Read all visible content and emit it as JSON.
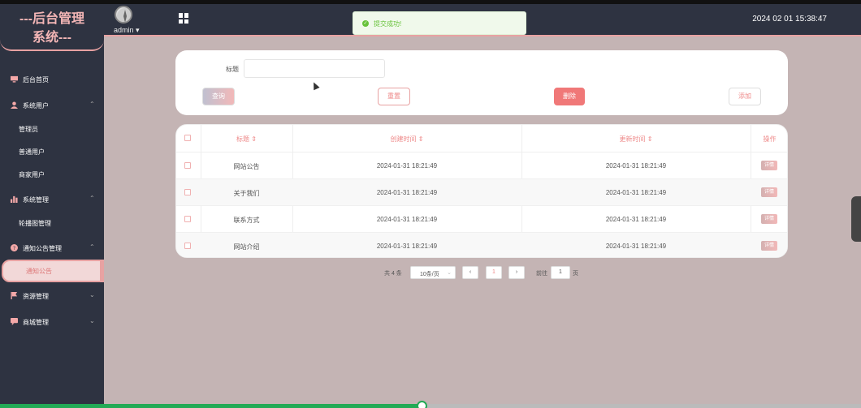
{
  "app": {
    "logo_line1": "---后台管理",
    "logo_line2": "系统---"
  },
  "header": {
    "user": "admin",
    "user_caret": "▾",
    "datetime": "2024 02 01 15:38:47"
  },
  "toast": {
    "icon": "✓",
    "message": "提交成功!"
  },
  "sidebar": {
    "items": [
      {
        "label": "后台首页",
        "icon": "monitor-icon",
        "chev": ""
      },
      {
        "label": "系统用户",
        "icon": "user-icon",
        "chev": "⌃"
      },
      {
        "label": "系统管理",
        "icon": "bar-chart-icon",
        "chev": "⌃"
      },
      {
        "label": "通知公告管理",
        "icon": "question-icon",
        "chev": "⌃"
      },
      {
        "label": "资源管理",
        "icon": "flag-icon",
        "chev": "⌄"
      },
      {
        "label": "商城管理",
        "icon": "chat-icon",
        "chev": "⌄"
      }
    ],
    "subitems": [
      {
        "label": "管理员"
      },
      {
        "label": "普通用户"
      },
      {
        "label": "商家用户"
      },
      {
        "label": "轮播图管理"
      },
      {
        "label": "通知公告"
      }
    ]
  },
  "search": {
    "title_label": "标题",
    "title_value": "",
    "query": "查询",
    "reset": "重置",
    "delete": "删除",
    "add": "添加"
  },
  "table": {
    "columns": [
      "标题 ⇕",
      "创建时间 ⇕",
      "更新时间 ⇕",
      "操作"
    ],
    "rows": [
      {
        "title": "网站公告",
        "created": "2024-01-31 18:21:49",
        "updated": "2024-01-31 18:21:49",
        "action": "详情"
      },
      {
        "title": "关于我们",
        "created": "2024-01-31 18:21:49",
        "updated": "2024-01-31 18:21:49",
        "action": "详情"
      },
      {
        "title": "联系方式",
        "created": "2024-01-31 18:21:49",
        "updated": "2024-01-31 18:21:49",
        "action": "详情"
      },
      {
        "title": "网站介绍",
        "created": "2024-01-31 18:21:49",
        "updated": "2024-01-31 18:21:49",
        "action": "详情"
      }
    ]
  },
  "pagination": {
    "total": "共 4 条",
    "page_size": "10条/页",
    "prev": "‹",
    "current_page": "1",
    "next": "›",
    "goto": "前往",
    "jump_value": "1",
    "page_suffix": "页"
  },
  "progress": {
    "fraction": 0.49
  },
  "colors": {
    "accent": "#e8a2a2",
    "sidebar": "#2e3341",
    "danger": "#f07878",
    "success": "#67c23a"
  }
}
